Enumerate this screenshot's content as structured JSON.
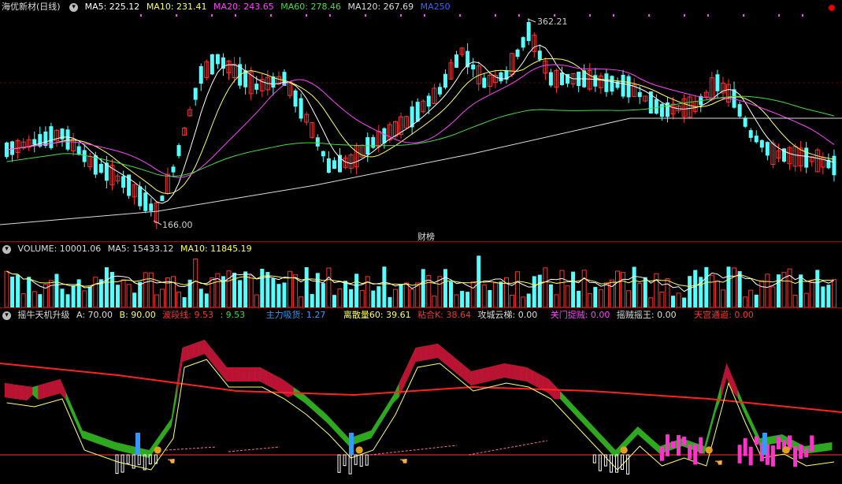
{
  "price_panel": {
    "title": "海优新材(日线)",
    "ma": [
      {
        "label": "MA5: 225.12",
        "color": "#ffffff"
      },
      {
        "label": "MA10: 231.41",
        "color": "#ffff55"
      },
      {
        "label": "MA20: 243.65",
        "color": "#ff44ff"
      },
      {
        "label": "MA60: 278.46",
        "color": "#44dd44"
      },
      {
        "label": "MA120: 267.69",
        "color": "#dddddd"
      },
      {
        "label": "MA250",
        "color": "#3366ff"
      }
    ],
    "high_label": "362.21",
    "low_label": "166.00",
    "event_label": "财榜"
  },
  "volume_panel": {
    "items": [
      {
        "label": "VOLUME: 10001.06",
        "color": "#dddddd"
      },
      {
        "label": "MA5: 15433.12",
        "color": "#dddddd"
      },
      {
        "label": "MA10: 11845.19",
        "color": "#ffff55"
      }
    ]
  },
  "indicator_panel": {
    "items": [
      {
        "label": "摇牛天机升级",
        "color": "#dddddd"
      },
      {
        "label": "A: 70.00",
        "color": "#dddddd"
      },
      {
        "label": "B: 90.00",
        "color": "#ffff55"
      },
      {
        "label": "波段线: 9.53",
        "color": "#ff3333"
      },
      {
        "label": ": 9.53",
        "color": "#33dd33"
      },
      {
        "label": "主力吸货: 1.27",
        "color": "#3399ff"
      },
      {
        "label": "离散量60: 39.61",
        "color": "#ffff55"
      },
      {
        "label": "粘合K: 38.64",
        "color": "#ff3333"
      },
      {
        "label": "攻城云梯: 0.00",
        "color": "#dddddd"
      },
      {
        "label": "关门捉贼: 0.00",
        "color": "#ff44ff"
      },
      {
        "label": "摇贼摇王: 0.00",
        "color": "#dddddd"
      },
      {
        "label": "天宫通道: 0.00",
        "color": "#ff3333"
      }
    ]
  },
  "colors": {
    "up": "#ff3333",
    "down": "#55ffff",
    "separator": "#b00000"
  },
  "icons": [
    "menu-circle-icon",
    "money-bag-icon",
    "hand-pointer-icon",
    "red-dot-icon",
    "close-icon"
  ]
}
